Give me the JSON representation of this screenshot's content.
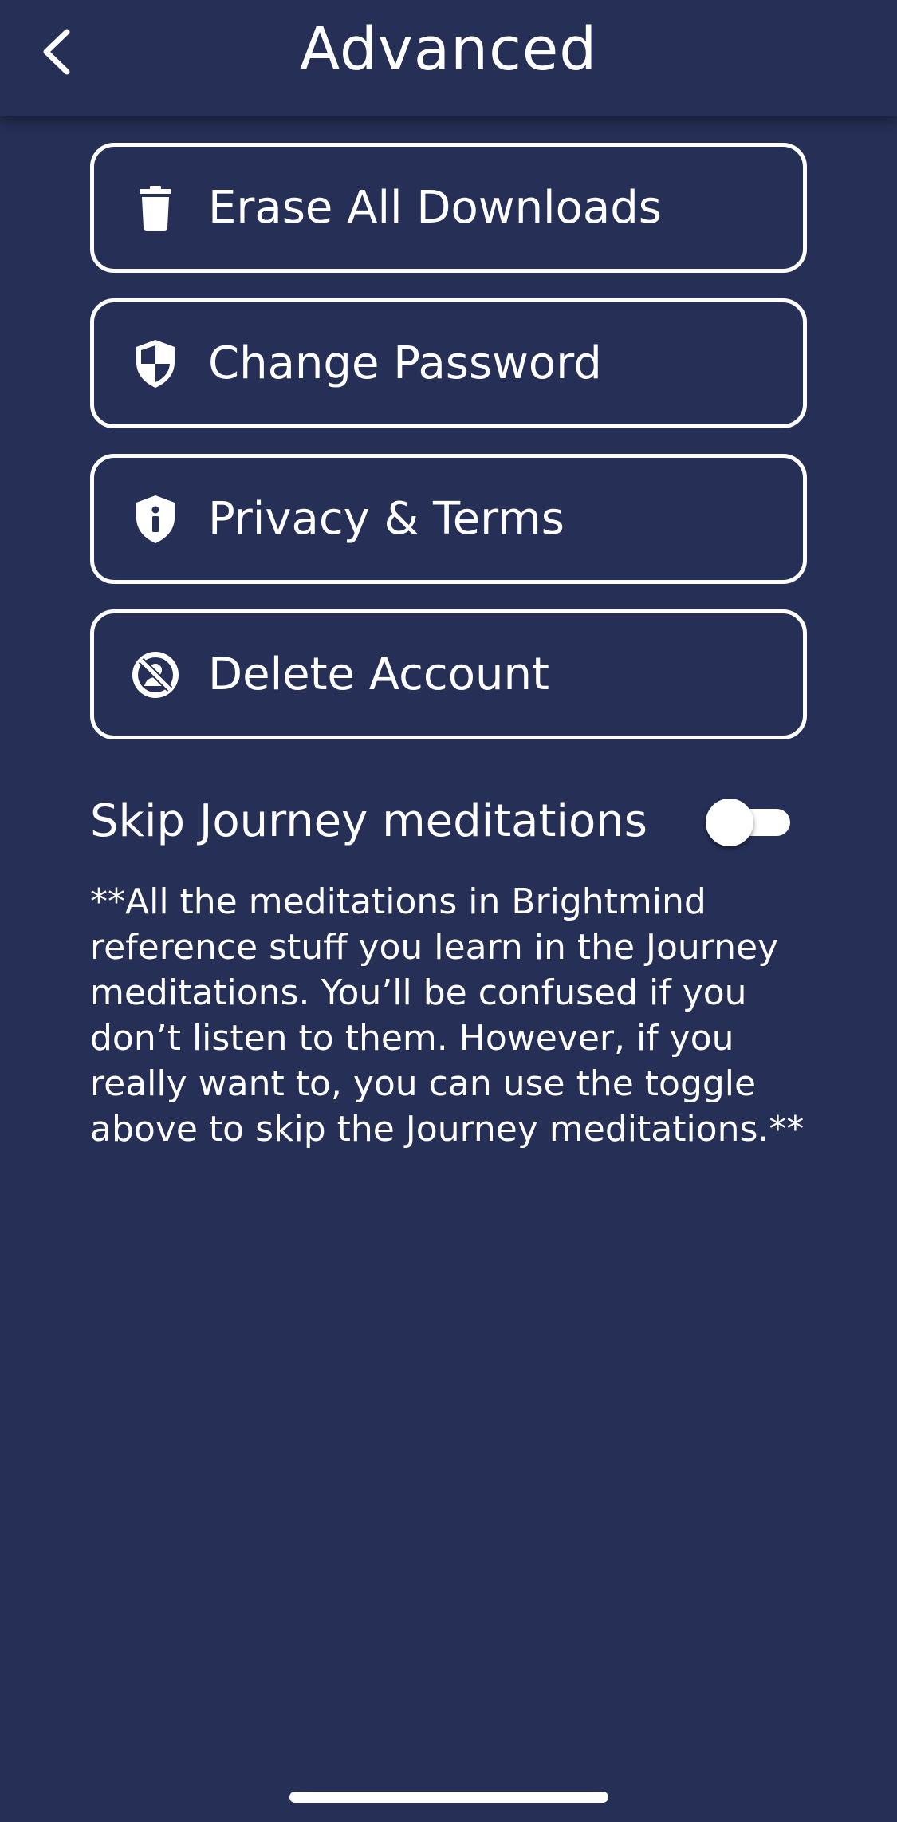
{
  "header": {
    "title": "Advanced",
    "back_icon": "chevron-left-icon"
  },
  "menu": [
    {
      "id": "erase-all-downloads",
      "label": "Erase All Downloads",
      "icon": "trash-icon"
    },
    {
      "id": "change-password",
      "label": "Change Password",
      "icon": "shield-halved-icon"
    },
    {
      "id": "privacy-terms",
      "label": "Privacy & Terms",
      "icon": "shield-info-icon"
    },
    {
      "id": "delete-account",
      "label": "Delete Account",
      "icon": "user-slash-icon"
    }
  ],
  "skip_journey": {
    "label": "Skip Journey meditations",
    "enabled": false
  },
  "note": "**All the meditations in Brightmind reference stuff you learn in the Journey meditations. You’ll be confused if you don’t listen to them. However, if you really want to, you can use the toggle above to skip the Journey meditations.**",
  "colors": {
    "background": "#262f55",
    "foreground": "#ffffff"
  }
}
